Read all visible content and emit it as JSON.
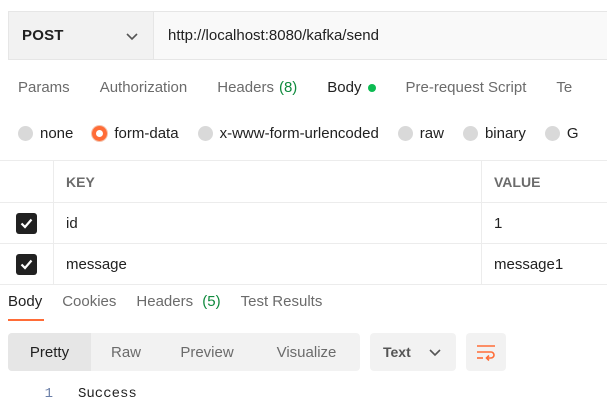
{
  "request": {
    "method": "POST",
    "url": "http://localhost:8080/kafka/send"
  },
  "request_tabs": [
    {
      "label": "Params"
    },
    {
      "label": "Authorization"
    },
    {
      "label": "Headers",
      "count": "(8)"
    },
    {
      "label": "Body",
      "active": true
    },
    {
      "label": "Pre-request Script"
    },
    {
      "label": "Te"
    }
  ],
  "body_types": [
    {
      "label": "none"
    },
    {
      "label": "form-data",
      "selected": true
    },
    {
      "label": "x-www-form-urlencoded"
    },
    {
      "label": "raw"
    },
    {
      "label": "binary"
    },
    {
      "label": "G"
    }
  ],
  "form_table": {
    "headers": {
      "key": "KEY",
      "value": "VALUE"
    },
    "rows": [
      {
        "checked": true,
        "key": "id",
        "value": "1"
      },
      {
        "checked": true,
        "key": "message",
        "value": "message1"
      }
    ]
  },
  "response_tabs": [
    {
      "label": "Body",
      "active": true
    },
    {
      "label": "Cookies"
    },
    {
      "label": "Headers",
      "count": "(5)"
    },
    {
      "label": "Test Results"
    }
  ],
  "view_modes": [
    {
      "label": "Pretty",
      "active": true
    },
    {
      "label": "Raw"
    },
    {
      "label": "Preview"
    },
    {
      "label": "Visualize"
    }
  ],
  "language": "Text",
  "response_body": [
    {
      "line": "1",
      "text": "Success"
    }
  ],
  "colors": {
    "accent": "#ff6c37",
    "count_green": "#0f8a3d",
    "body_dot": "#0cbb52"
  }
}
